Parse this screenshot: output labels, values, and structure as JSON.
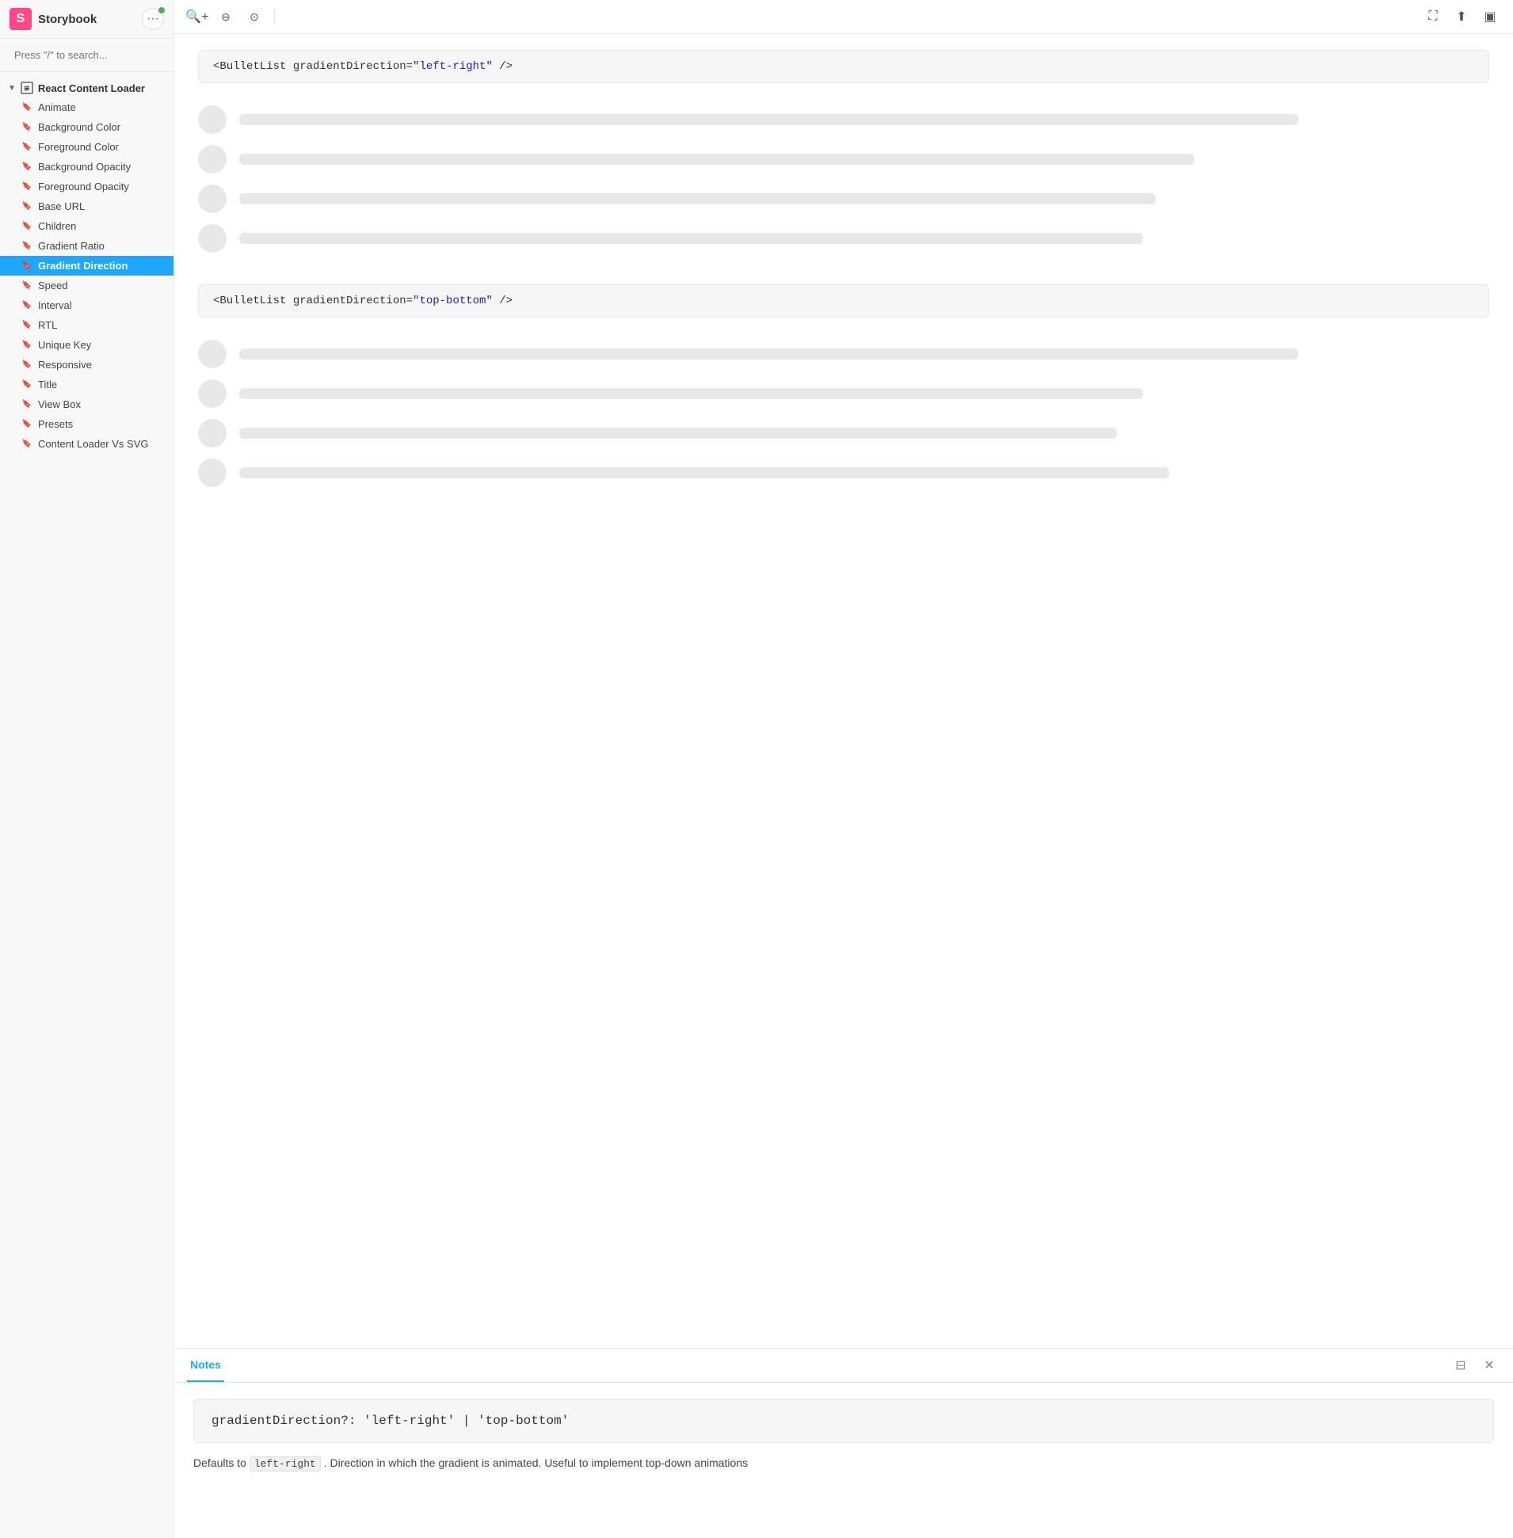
{
  "sidebar": {
    "logo_text": "Storybook",
    "more_button_label": "···",
    "search_placeholder": "Press \"/\" to search...",
    "nav_group": {
      "label": "React Content Loader",
      "items": [
        {
          "id": "animate",
          "label": "Animate",
          "active": false
        },
        {
          "id": "background-color",
          "label": "Background Color",
          "active": false
        },
        {
          "id": "foreground-color",
          "label": "Foreground Color",
          "active": false
        },
        {
          "id": "background-opacity",
          "label": "Background Opacity",
          "active": false
        },
        {
          "id": "foreground-opacity",
          "label": "Foreground Opacity",
          "active": false
        },
        {
          "id": "base-url",
          "label": "Base URL",
          "active": false
        },
        {
          "id": "children",
          "label": "Children",
          "active": false
        },
        {
          "id": "gradient-ratio",
          "label": "Gradient Ratio",
          "active": false
        },
        {
          "id": "gradient-direction",
          "label": "Gradient Direction",
          "active": true
        },
        {
          "id": "speed",
          "label": "Speed",
          "active": false
        },
        {
          "id": "interval",
          "label": "Interval",
          "active": false
        },
        {
          "id": "rtl",
          "label": "RTL",
          "active": false
        },
        {
          "id": "unique-key",
          "label": "Unique Key",
          "active": false
        },
        {
          "id": "responsive",
          "label": "Responsive",
          "active": false
        },
        {
          "id": "title",
          "label": "Title",
          "active": false
        },
        {
          "id": "view-box",
          "label": "View Box",
          "active": false
        },
        {
          "id": "presets",
          "label": "Presets",
          "active": false
        },
        {
          "id": "content-loader-vs-svg",
          "label": "Content Loader Vs SVG",
          "active": false
        }
      ]
    }
  },
  "toolbar": {
    "zoom_in": "zoom-in",
    "zoom_out": "zoom-out",
    "zoom_reset": "zoom-reset",
    "fullscreen": "fullscreen",
    "share": "share",
    "sidebar_toggle": "sidebar"
  },
  "main": {
    "section1": {
      "code_label": "<BulletList gradientDirection=",
      "code_value": "\"left-right\"",
      "code_end": " />",
      "bullet_lines": [
        {
          "width": "82%"
        },
        {
          "width": "74%"
        },
        {
          "width": "71%"
        },
        {
          "width": "70%"
        }
      ]
    },
    "section2": {
      "code_label": "<BulletList gradientDirection=",
      "code_value": "\"top-bottom\"",
      "code_end": " />",
      "bullet_lines": [
        {
          "width": "82%"
        },
        {
          "width": "70%"
        },
        {
          "width": "68%"
        },
        {
          "width": "72%"
        }
      ]
    }
  },
  "notes": {
    "tab_label": "Notes",
    "close_btn": "×",
    "panel_btn": "⊟",
    "code_block": "gradientDirection?: 'left-right' | 'top-bottom'",
    "desc_prefix": "Defaults to ",
    "desc_code": "left-right",
    "desc_suffix": ". Direction in which the gradient is animated. Useful to implement top-down animations"
  }
}
